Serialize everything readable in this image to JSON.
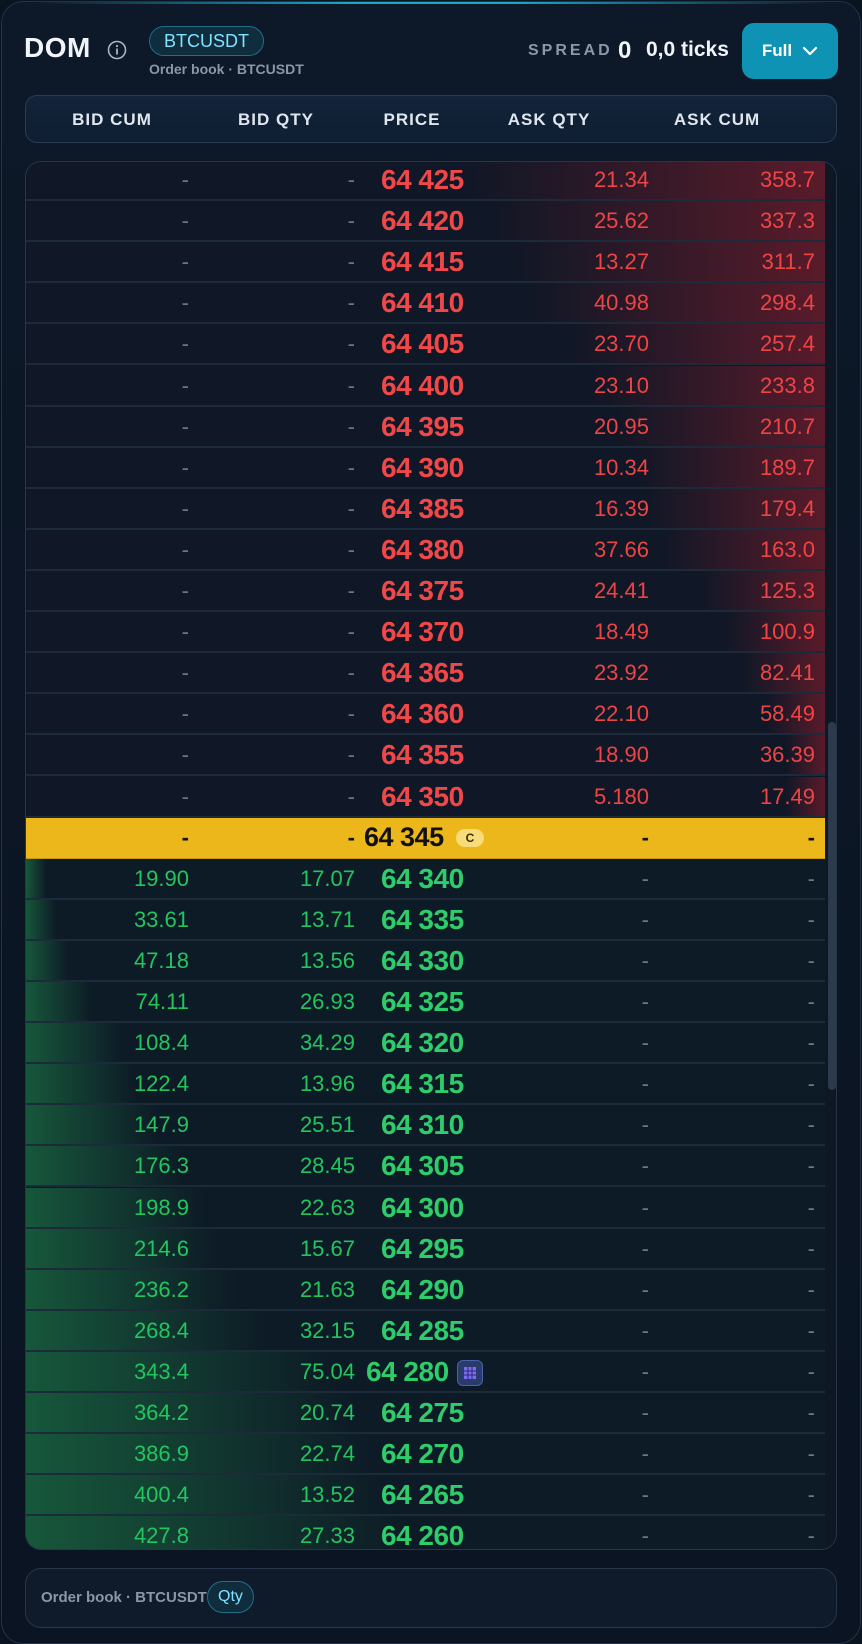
{
  "header": {
    "title": "DOM",
    "symbol": "BTCUSDT",
    "subtitle": "Order book · BTCUSDT",
    "spread_label": "SPREAD",
    "spread_value": "0",
    "spread_ticks": "0,0 ticks",
    "mode_button": "Full"
  },
  "columns": [
    "BID CUM",
    "BID QTY",
    "PRICE",
    "ASK QTY",
    "ASK CUM"
  ],
  "colors": {
    "ask": "#ef4444",
    "bid": "#22c55e",
    "last": "#ecb71a",
    "accent": "#0f93b5"
  },
  "icons": [
    "info-icon",
    "chevron-down-icon",
    "grid-icon"
  ],
  "last_price_badge": "C",
  "rows": [
    {
      "side": "ask",
      "bid_cum": "-",
      "bid_qty": "-",
      "price": "64 425",
      "ask_qty": "21.34",
      "ask_cum": "358.7"
    },
    {
      "side": "ask",
      "bid_cum": "-",
      "bid_qty": "-",
      "price": "64 420",
      "ask_qty": "25.62",
      "ask_cum": "337.3"
    },
    {
      "side": "ask",
      "bid_cum": "-",
      "bid_qty": "-",
      "price": "64 415",
      "ask_qty": "13.27",
      "ask_cum": "311.7"
    },
    {
      "side": "ask",
      "bid_cum": "-",
      "bid_qty": "-",
      "price": "64 410",
      "ask_qty": "40.98",
      "ask_cum": "298.4"
    },
    {
      "side": "ask",
      "bid_cum": "-",
      "bid_qty": "-",
      "price": "64 405",
      "ask_qty": "23.70",
      "ask_cum": "257.4"
    },
    {
      "side": "ask",
      "bid_cum": "-",
      "bid_qty": "-",
      "price": "64 400",
      "ask_qty": "23.10",
      "ask_cum": "233.8"
    },
    {
      "side": "ask",
      "bid_cum": "-",
      "bid_qty": "-",
      "price": "64 395",
      "ask_qty": "20.95",
      "ask_cum": "210.7"
    },
    {
      "side": "ask",
      "bid_cum": "-",
      "bid_qty": "-",
      "price": "64 390",
      "ask_qty": "10.34",
      "ask_cum": "189.7"
    },
    {
      "side": "ask",
      "bid_cum": "-",
      "bid_qty": "-",
      "price": "64 385",
      "ask_qty": "16.39",
      "ask_cum": "179.4"
    },
    {
      "side": "ask",
      "bid_cum": "-",
      "bid_qty": "-",
      "price": "64 380",
      "ask_qty": "37.66",
      "ask_cum": "163.0"
    },
    {
      "side": "ask",
      "bid_cum": "-",
      "bid_qty": "-",
      "price": "64 375",
      "ask_qty": "24.41",
      "ask_cum": "125.3"
    },
    {
      "side": "ask",
      "bid_cum": "-",
      "bid_qty": "-",
      "price": "64 370",
      "ask_qty": "18.49",
      "ask_cum": "100.9"
    },
    {
      "side": "ask",
      "bid_cum": "-",
      "bid_qty": "-",
      "price": "64 365",
      "ask_qty": "23.92",
      "ask_cum": "82.41"
    },
    {
      "side": "ask",
      "bid_cum": "-",
      "bid_qty": "-",
      "price": "64 360",
      "ask_qty": "22.10",
      "ask_cum": "58.49"
    },
    {
      "side": "ask",
      "bid_cum": "-",
      "bid_qty": "-",
      "price": "64 355",
      "ask_qty": "18.90",
      "ask_cum": "36.39"
    },
    {
      "side": "ask",
      "bid_cum": "-",
      "bid_qty": "-",
      "price": "64 350",
      "ask_qty": "5.180",
      "ask_cum": "17.49"
    },
    {
      "side": "mid",
      "bid_cum": "-",
      "bid_qty": "-",
      "price": "64 345",
      "ask_qty": "-",
      "ask_cum": "-"
    },
    {
      "side": "bid",
      "bid_cum": "19.90",
      "bid_qty": "17.07",
      "price": "64 340",
      "ask_qty": "-",
      "ask_cum": "-"
    },
    {
      "side": "bid",
      "bid_cum": "33.61",
      "bid_qty": "13.71",
      "price": "64 335",
      "ask_qty": "-",
      "ask_cum": "-"
    },
    {
      "side": "bid",
      "bid_cum": "47.18",
      "bid_qty": "13.56",
      "price": "64 330",
      "ask_qty": "-",
      "ask_cum": "-"
    },
    {
      "side": "bid",
      "bid_cum": "74.11",
      "bid_qty": "26.93",
      "price": "64 325",
      "ask_qty": "-",
      "ask_cum": "-"
    },
    {
      "side": "bid",
      "bid_cum": "108.4",
      "bid_qty": "34.29",
      "price": "64 320",
      "ask_qty": "-",
      "ask_cum": "-"
    },
    {
      "side": "bid",
      "bid_cum": "122.4",
      "bid_qty": "13.96",
      "price": "64 315",
      "ask_qty": "-",
      "ask_cum": "-"
    },
    {
      "side": "bid",
      "bid_cum": "147.9",
      "bid_qty": "25.51",
      "price": "64 310",
      "ask_qty": "-",
      "ask_cum": "-"
    },
    {
      "side": "bid",
      "bid_cum": "176.3",
      "bid_qty": "28.45",
      "price": "64 305",
      "ask_qty": "-",
      "ask_cum": "-"
    },
    {
      "side": "bid",
      "bid_cum": "198.9",
      "bid_qty": "22.63",
      "price": "64 300",
      "ask_qty": "-",
      "ask_cum": "-"
    },
    {
      "side": "bid",
      "bid_cum": "214.6",
      "bid_qty": "15.67",
      "price": "64 295",
      "ask_qty": "-",
      "ask_cum": "-"
    },
    {
      "side": "bid",
      "bid_cum": "236.2",
      "bid_qty": "21.63",
      "price": "64 290",
      "ask_qty": "-",
      "ask_cum": "-"
    },
    {
      "side": "bid",
      "bid_cum": "268.4",
      "bid_qty": "32.15",
      "price": "64 285",
      "ask_qty": "-",
      "ask_cum": "-"
    },
    {
      "side": "bid",
      "bid_cum": "343.4",
      "bid_qty": "75.04",
      "price": "64 280",
      "ask_qty": "-",
      "ask_cum": "-",
      "marker": "grid-icon"
    },
    {
      "side": "bid",
      "bid_cum": "364.2",
      "bid_qty": "20.74",
      "price": "64 275",
      "ask_qty": "-",
      "ask_cum": "-"
    },
    {
      "side": "bid",
      "bid_cum": "386.9",
      "bid_qty": "22.74",
      "price": "64 270",
      "ask_qty": "-",
      "ask_cum": "-"
    },
    {
      "side": "bid",
      "bid_cum": "400.4",
      "bid_qty": "13.52",
      "price": "64 265",
      "ask_qty": "-",
      "ask_cum": "-"
    },
    {
      "side": "bid",
      "bid_cum": "427.8",
      "bid_qty": "27.33",
      "price": "64 260",
      "ask_qty": "-",
      "ask_cum": "-"
    }
  ],
  "footer": {
    "label": "Order book · BTCUSDT",
    "mode_chip": "Qty"
  }
}
